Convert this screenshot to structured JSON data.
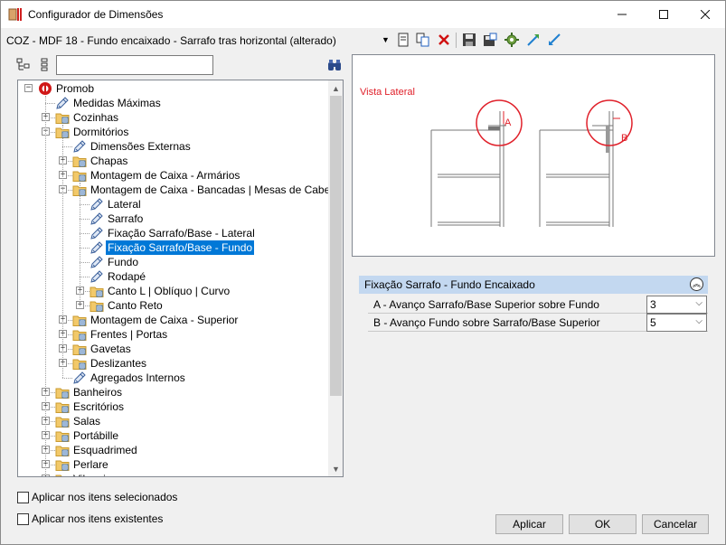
{
  "window": {
    "title": "Configurador de Dimensões",
    "icon": "ruler-panel-icon"
  },
  "toolbar": {
    "configuration_name": "COZ - MDF 18 - Fundo encaixado - Sarrafo tras horizontal (alterado)",
    "icons": [
      "new-icon",
      "copy-icon",
      "delete-icon",
      "save-icon",
      "save-as-icon",
      "settings-icon",
      "import-icon",
      "export-icon"
    ]
  },
  "tree_toolbar": {
    "search_value": "",
    "icons": [
      "expand-tree-icon",
      "collapse-tree-icon",
      "binoculars-icon"
    ]
  },
  "tree": {
    "nodes": [
      {
        "label": "Promob"
      },
      {
        "label": "Medidas Máximas"
      },
      {
        "label": "Cozinhas"
      },
      {
        "label": "Dormitórios"
      },
      {
        "label": "Dimensões Externas"
      },
      {
        "label": "Chapas"
      },
      {
        "label": "Montagem de Caixa - Armários"
      },
      {
        "label": "Montagem de Caixa - Bancadas | Mesas de Cabeceira"
      },
      {
        "label": "Lateral"
      },
      {
        "label": "Sarrafo"
      },
      {
        "label": "Fixação Sarrafo/Base - Lateral"
      },
      {
        "label": "Fixação Sarrafo/Base - Fundo"
      },
      {
        "label": "Fundo"
      },
      {
        "label": "Rodapé"
      },
      {
        "label": "Canto L | Oblíquo | Curvo"
      },
      {
        "label": "Canto Reto"
      },
      {
        "label": "Montagem de Caixa - Superior"
      },
      {
        "label": "Frentes | Portas"
      },
      {
        "label": "Gavetas"
      },
      {
        "label": "Deslizantes"
      },
      {
        "label": "Agregados Internos"
      },
      {
        "label": "Banheiros"
      },
      {
        "label": "Escritórios"
      },
      {
        "label": "Salas"
      },
      {
        "label": "Portábille"
      },
      {
        "label": "Esquadrimed"
      },
      {
        "label": "Perlare"
      },
      {
        "label": "Vilaggio"
      }
    ]
  },
  "options": {
    "apply_selected": "Aplicar nos itens selecionados",
    "apply_existing": "Aplicar nos itens existentes"
  },
  "preview": {
    "view_label": "Vista Lateral",
    "marker_a": "A",
    "marker_b": "B",
    "accent_color": "#e0202a"
  },
  "properties": {
    "title": "Fixação Sarrafo - Fundo Encaixado",
    "rows": [
      {
        "label": "A - Avanço Sarrafo/Base Superior sobre Fundo",
        "value": "3"
      },
      {
        "label": "B - Avanço Fundo sobre Sarrafo/Base Superior",
        "value": "5"
      }
    ]
  },
  "buttons": {
    "apply": "Aplicar",
    "ok": "OK",
    "cancel": "Cancelar"
  }
}
